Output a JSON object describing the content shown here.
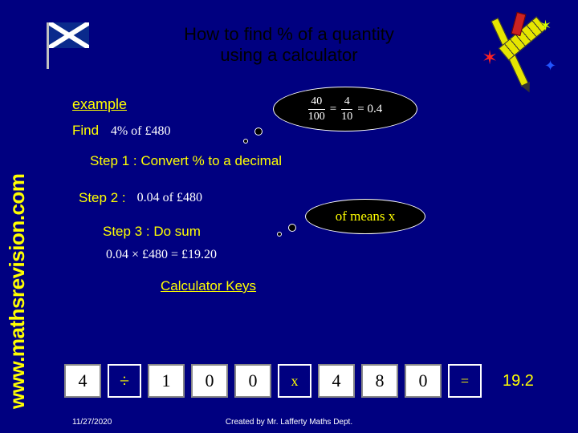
{
  "title_line1": "How to find % of a quantity",
  "title_line2": "using a calculator",
  "sidebar": "www.mathsrevision.com",
  "example_label": "example",
  "find_label": "Find",
  "find_expr": "4% of £480",
  "bubble_frac": {
    "num1": "40",
    "den1": "100",
    "mid": "=",
    "num2": "4",
    "den2": "10",
    "eq": "= 0.4"
  },
  "step1": "Step 1 : Convert % to a decimal",
  "step2_label": "Step 2 :",
  "step2_expr": "0.04 of £480",
  "bubble_means": "of means x",
  "step3": "Step 3 : Do sum",
  "step3_expr": "0.04 × £480 = £19.20",
  "calc_heading": "Calculator Keys",
  "keys": {
    "k1": "4",
    "k2": "÷",
    "k3": "1",
    "k4": "0",
    "k5": "0",
    "k6": "x",
    "k7": "4",
    "k8": "8",
    "k9": "0",
    "k10": "="
  },
  "answer": "19.2",
  "footer_date": "11/27/2020",
  "footer_credit": "Created by Mr. Lafferty Maths Dept."
}
